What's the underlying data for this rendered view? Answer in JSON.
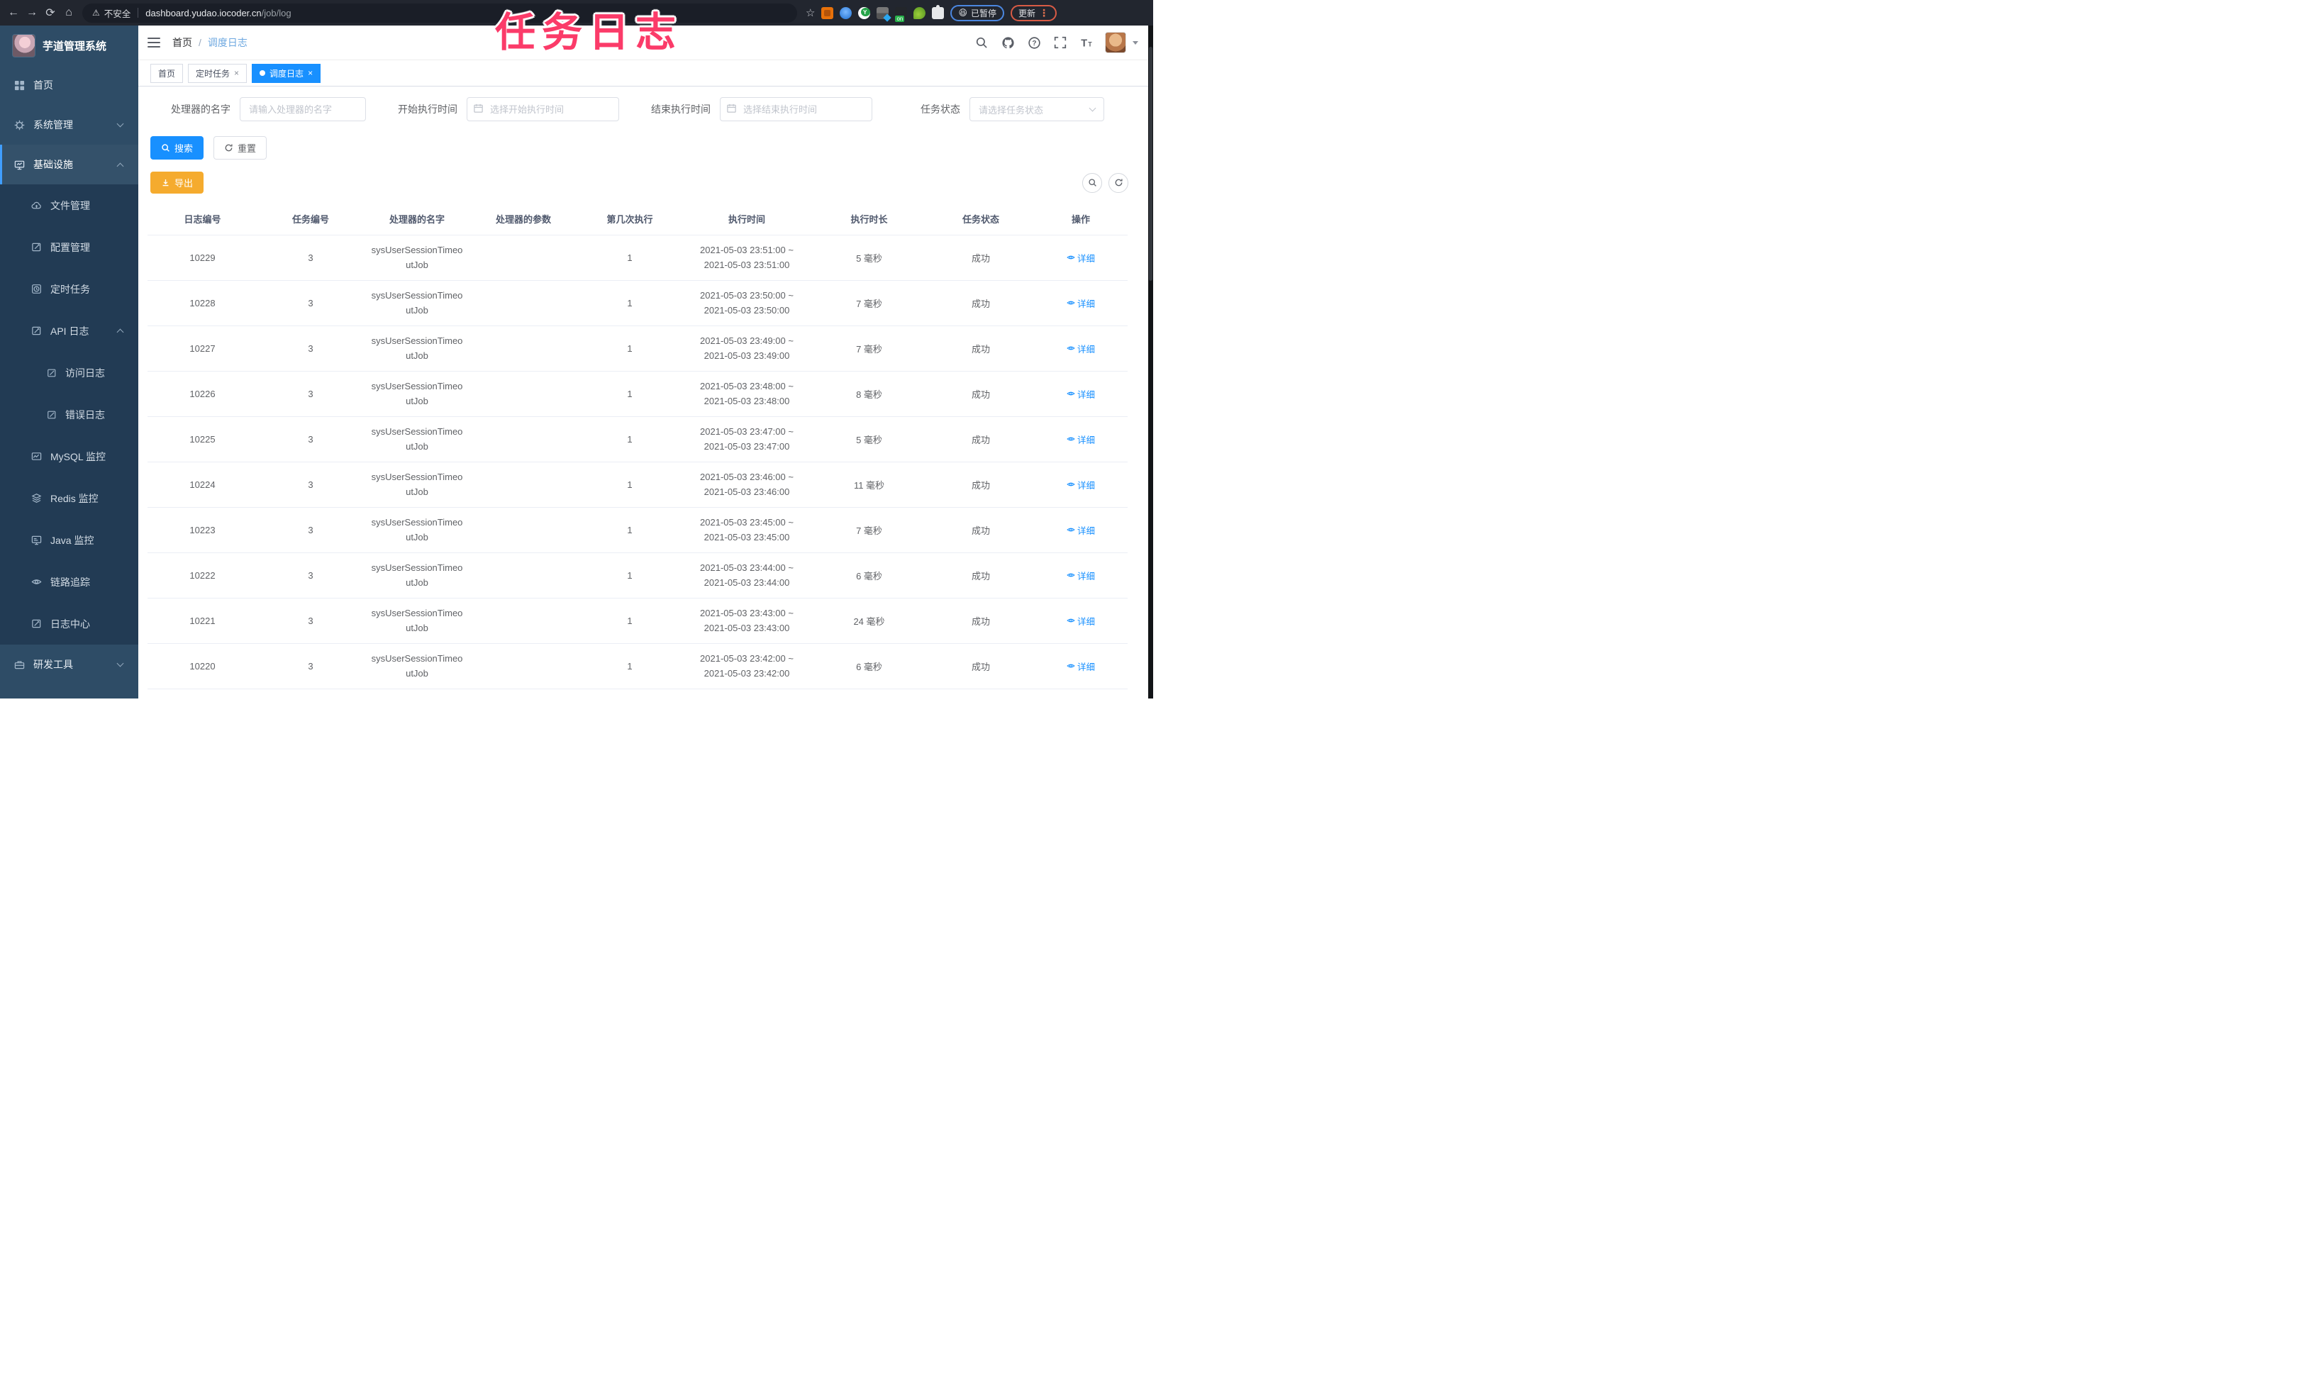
{
  "colors": {
    "accent": "#1890ff",
    "warning_button": "#f5ab2e",
    "overlay_text": "#fb3b69",
    "tab_active_bg": "#1890ff"
  },
  "icons": {
    "back": "←",
    "forward": "→",
    "reload": "⟳",
    "home": "⌂",
    "warning": "⚠",
    "star": "☆",
    "more_vertical": "⋮",
    "close": "×",
    "breadcrumb_separator": "/",
    "paused_emoji": "😆",
    "extension_badge": "on"
  },
  "browser": {
    "security_label": "不安全",
    "url_host": "dashboard.yudao.iocoder.cn",
    "url_path": "/job/log",
    "paused_button": "已暂停",
    "update_button": "更新"
  },
  "overlay_title": "任务日志",
  "sidebar": {
    "title": "芋道管理系统",
    "items": [
      {
        "label": "首页"
      },
      {
        "label": "系统管理"
      },
      {
        "label": "基础设施",
        "children": [
          {
            "label": "文件管理"
          },
          {
            "label": "配置管理"
          },
          {
            "label": "定时任务"
          },
          {
            "label": "API 日志",
            "children": [
              {
                "label": "访问日志"
              },
              {
                "label": "错误日志"
              }
            ]
          },
          {
            "label": "MySQL 监控"
          },
          {
            "label": "Redis 监控"
          },
          {
            "label": "Java 监控"
          },
          {
            "label": "链路追踪"
          },
          {
            "label": "日志中心"
          }
        ]
      },
      {
        "label": "研发工具"
      }
    ]
  },
  "header": {
    "breadcrumb": [
      "首页",
      "调度日志"
    ]
  },
  "tabs": [
    {
      "label": "首页",
      "active": false,
      "closable": false
    },
    {
      "label": "定时任务",
      "active": false,
      "closable": true
    },
    {
      "label": "调度日志",
      "active": true,
      "closable": true
    }
  ],
  "filters": {
    "handler_name": {
      "label": "处理器的名字",
      "placeholder": "请输入处理器的名字"
    },
    "begin_time": {
      "label": "开始执行时间",
      "placeholder": "选择开始执行时间"
    },
    "end_time": {
      "label": "结束执行时间",
      "placeholder": "选择结束执行时间"
    },
    "status": {
      "label": "任务状态",
      "placeholder": "请选择任务状态"
    }
  },
  "buttons": {
    "search": "搜索",
    "reset": "重置",
    "export": "导出"
  },
  "table": {
    "columns": [
      "日志编号",
      "任务编号",
      "处理器的名字",
      "处理器的参数",
      "第几次执行",
      "执行时间",
      "执行时长",
      "任务状态",
      "操作"
    ],
    "rows": [
      {
        "id": "10229",
        "task_id": "3",
        "handler": "sysUserSessionTimeoutJob",
        "param": "",
        "seq": "1",
        "time1": "2021-05-03 23:51:00 ~",
        "time2": "2021-05-03 23:51:00",
        "duration": "5 毫秒",
        "status": "成功",
        "action": "详细"
      },
      {
        "id": "10228",
        "task_id": "3",
        "handler": "sysUserSessionTimeoutJob",
        "param": "",
        "seq": "1",
        "time1": "2021-05-03 23:50:00 ~",
        "time2": "2021-05-03 23:50:00",
        "duration": "7 毫秒",
        "status": "成功",
        "action": "详细"
      },
      {
        "id": "10227",
        "task_id": "3",
        "handler": "sysUserSessionTimeoutJob",
        "param": "",
        "seq": "1",
        "time1": "2021-05-03 23:49:00 ~",
        "time2": "2021-05-03 23:49:00",
        "duration": "7 毫秒",
        "status": "成功",
        "action": "详细"
      },
      {
        "id": "10226",
        "task_id": "3",
        "handler": "sysUserSessionTimeoutJob",
        "param": "",
        "seq": "1",
        "time1": "2021-05-03 23:48:00 ~",
        "time2": "2021-05-03 23:48:00",
        "duration": "8 毫秒",
        "status": "成功",
        "action": "详细"
      },
      {
        "id": "10225",
        "task_id": "3",
        "handler": "sysUserSessionTimeoutJob",
        "param": "",
        "seq": "1",
        "time1": "2021-05-03 23:47:00 ~",
        "time2": "2021-05-03 23:47:00",
        "duration": "5 毫秒",
        "status": "成功",
        "action": "详细"
      },
      {
        "id": "10224",
        "task_id": "3",
        "handler": "sysUserSessionTimeoutJob",
        "param": "",
        "seq": "1",
        "time1": "2021-05-03 23:46:00 ~",
        "time2": "2021-05-03 23:46:00",
        "duration": "11 毫秒",
        "status": "成功",
        "action": "详细"
      },
      {
        "id": "10223",
        "task_id": "3",
        "handler": "sysUserSessionTimeoutJob",
        "param": "",
        "seq": "1",
        "time1": "2021-05-03 23:45:00 ~",
        "time2": "2021-05-03 23:45:00",
        "duration": "7 毫秒",
        "status": "成功",
        "action": "详细"
      },
      {
        "id": "10222",
        "task_id": "3",
        "handler": "sysUserSessionTimeoutJob",
        "param": "",
        "seq": "1",
        "time1": "2021-05-03 23:44:00 ~",
        "time2": "2021-05-03 23:44:00",
        "duration": "6 毫秒",
        "status": "成功",
        "action": "详细"
      },
      {
        "id": "10221",
        "task_id": "3",
        "handler": "sysUserSessionTimeoutJob",
        "param": "",
        "seq": "1",
        "time1": "2021-05-03 23:43:00 ~",
        "time2": "2021-05-03 23:43:00",
        "duration": "24 毫秒",
        "status": "成功",
        "action": "详细"
      },
      {
        "id": "10220",
        "task_id": "3",
        "handler": "sysUserSessionTimeoutJob",
        "param": "",
        "seq": "1",
        "time1": "2021-05-03 23:42:00 ~",
        "time2": "2021-05-03 23:42:00",
        "duration": "6 毫秒",
        "status": "成功",
        "action": "详细"
      }
    ]
  }
}
